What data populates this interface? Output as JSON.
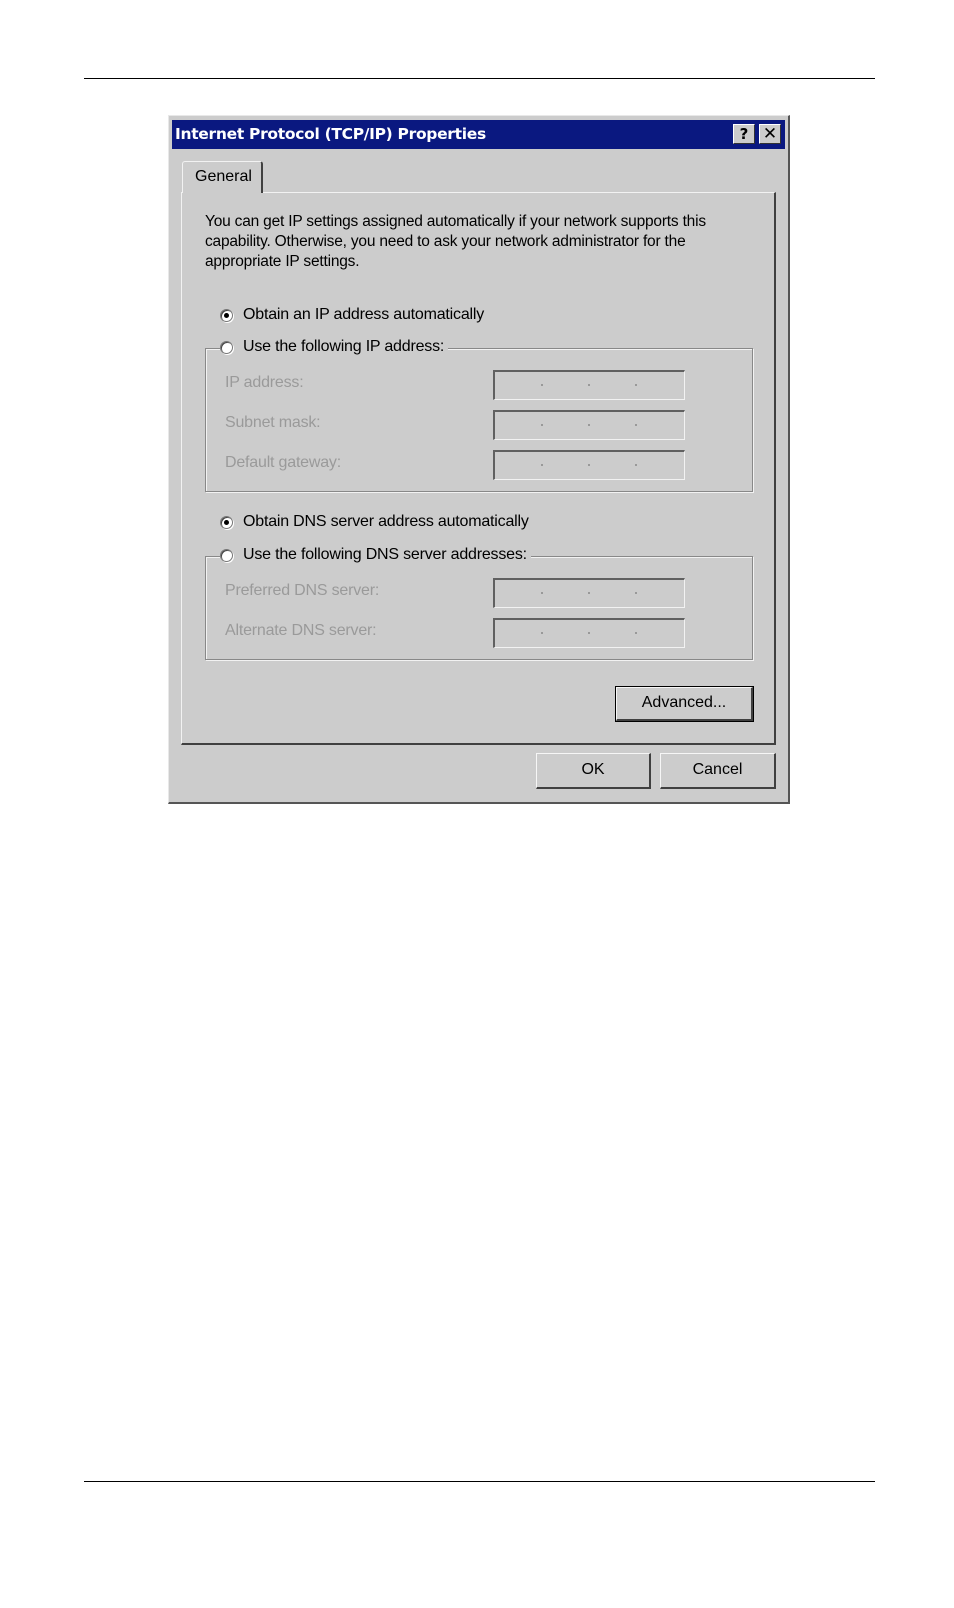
{
  "dialog": {
    "title": "Internet Protocol (TCP/IP) Properties",
    "help_button": "?",
    "close_button": "✕",
    "tabs": [
      {
        "label": "General",
        "active": true
      }
    ],
    "description": "You can get IP settings assigned automatically if your network supports this capability. Otherwise, you need to ask your network administrator for the appropriate IP settings.",
    "ip_section": {
      "auto_radio": {
        "label": "Obtain an IP address automatically",
        "checked": true
      },
      "manual_radio": {
        "label": "Use the following IP address:",
        "checked": false
      },
      "fields": [
        {
          "label": "IP address:",
          "value": ". . ."
        },
        {
          "label": "Subnet mask:",
          "value": ". . ."
        },
        {
          "label": "Default gateway:",
          "value": ". . ."
        }
      ]
    },
    "dns_section": {
      "auto_radio": {
        "label": "Obtain DNS server address automatically",
        "checked": true
      },
      "manual_radio": {
        "label": "Use the following DNS server addresses:",
        "checked": false
      },
      "fields": [
        {
          "label": "Preferred DNS server:",
          "value": ". . ."
        },
        {
          "label": "Alternate DNS server:",
          "value": ". . ."
        }
      ]
    },
    "advanced_button": "Advanced...",
    "ok_button": "OK",
    "cancel_button": "Cancel"
  }
}
